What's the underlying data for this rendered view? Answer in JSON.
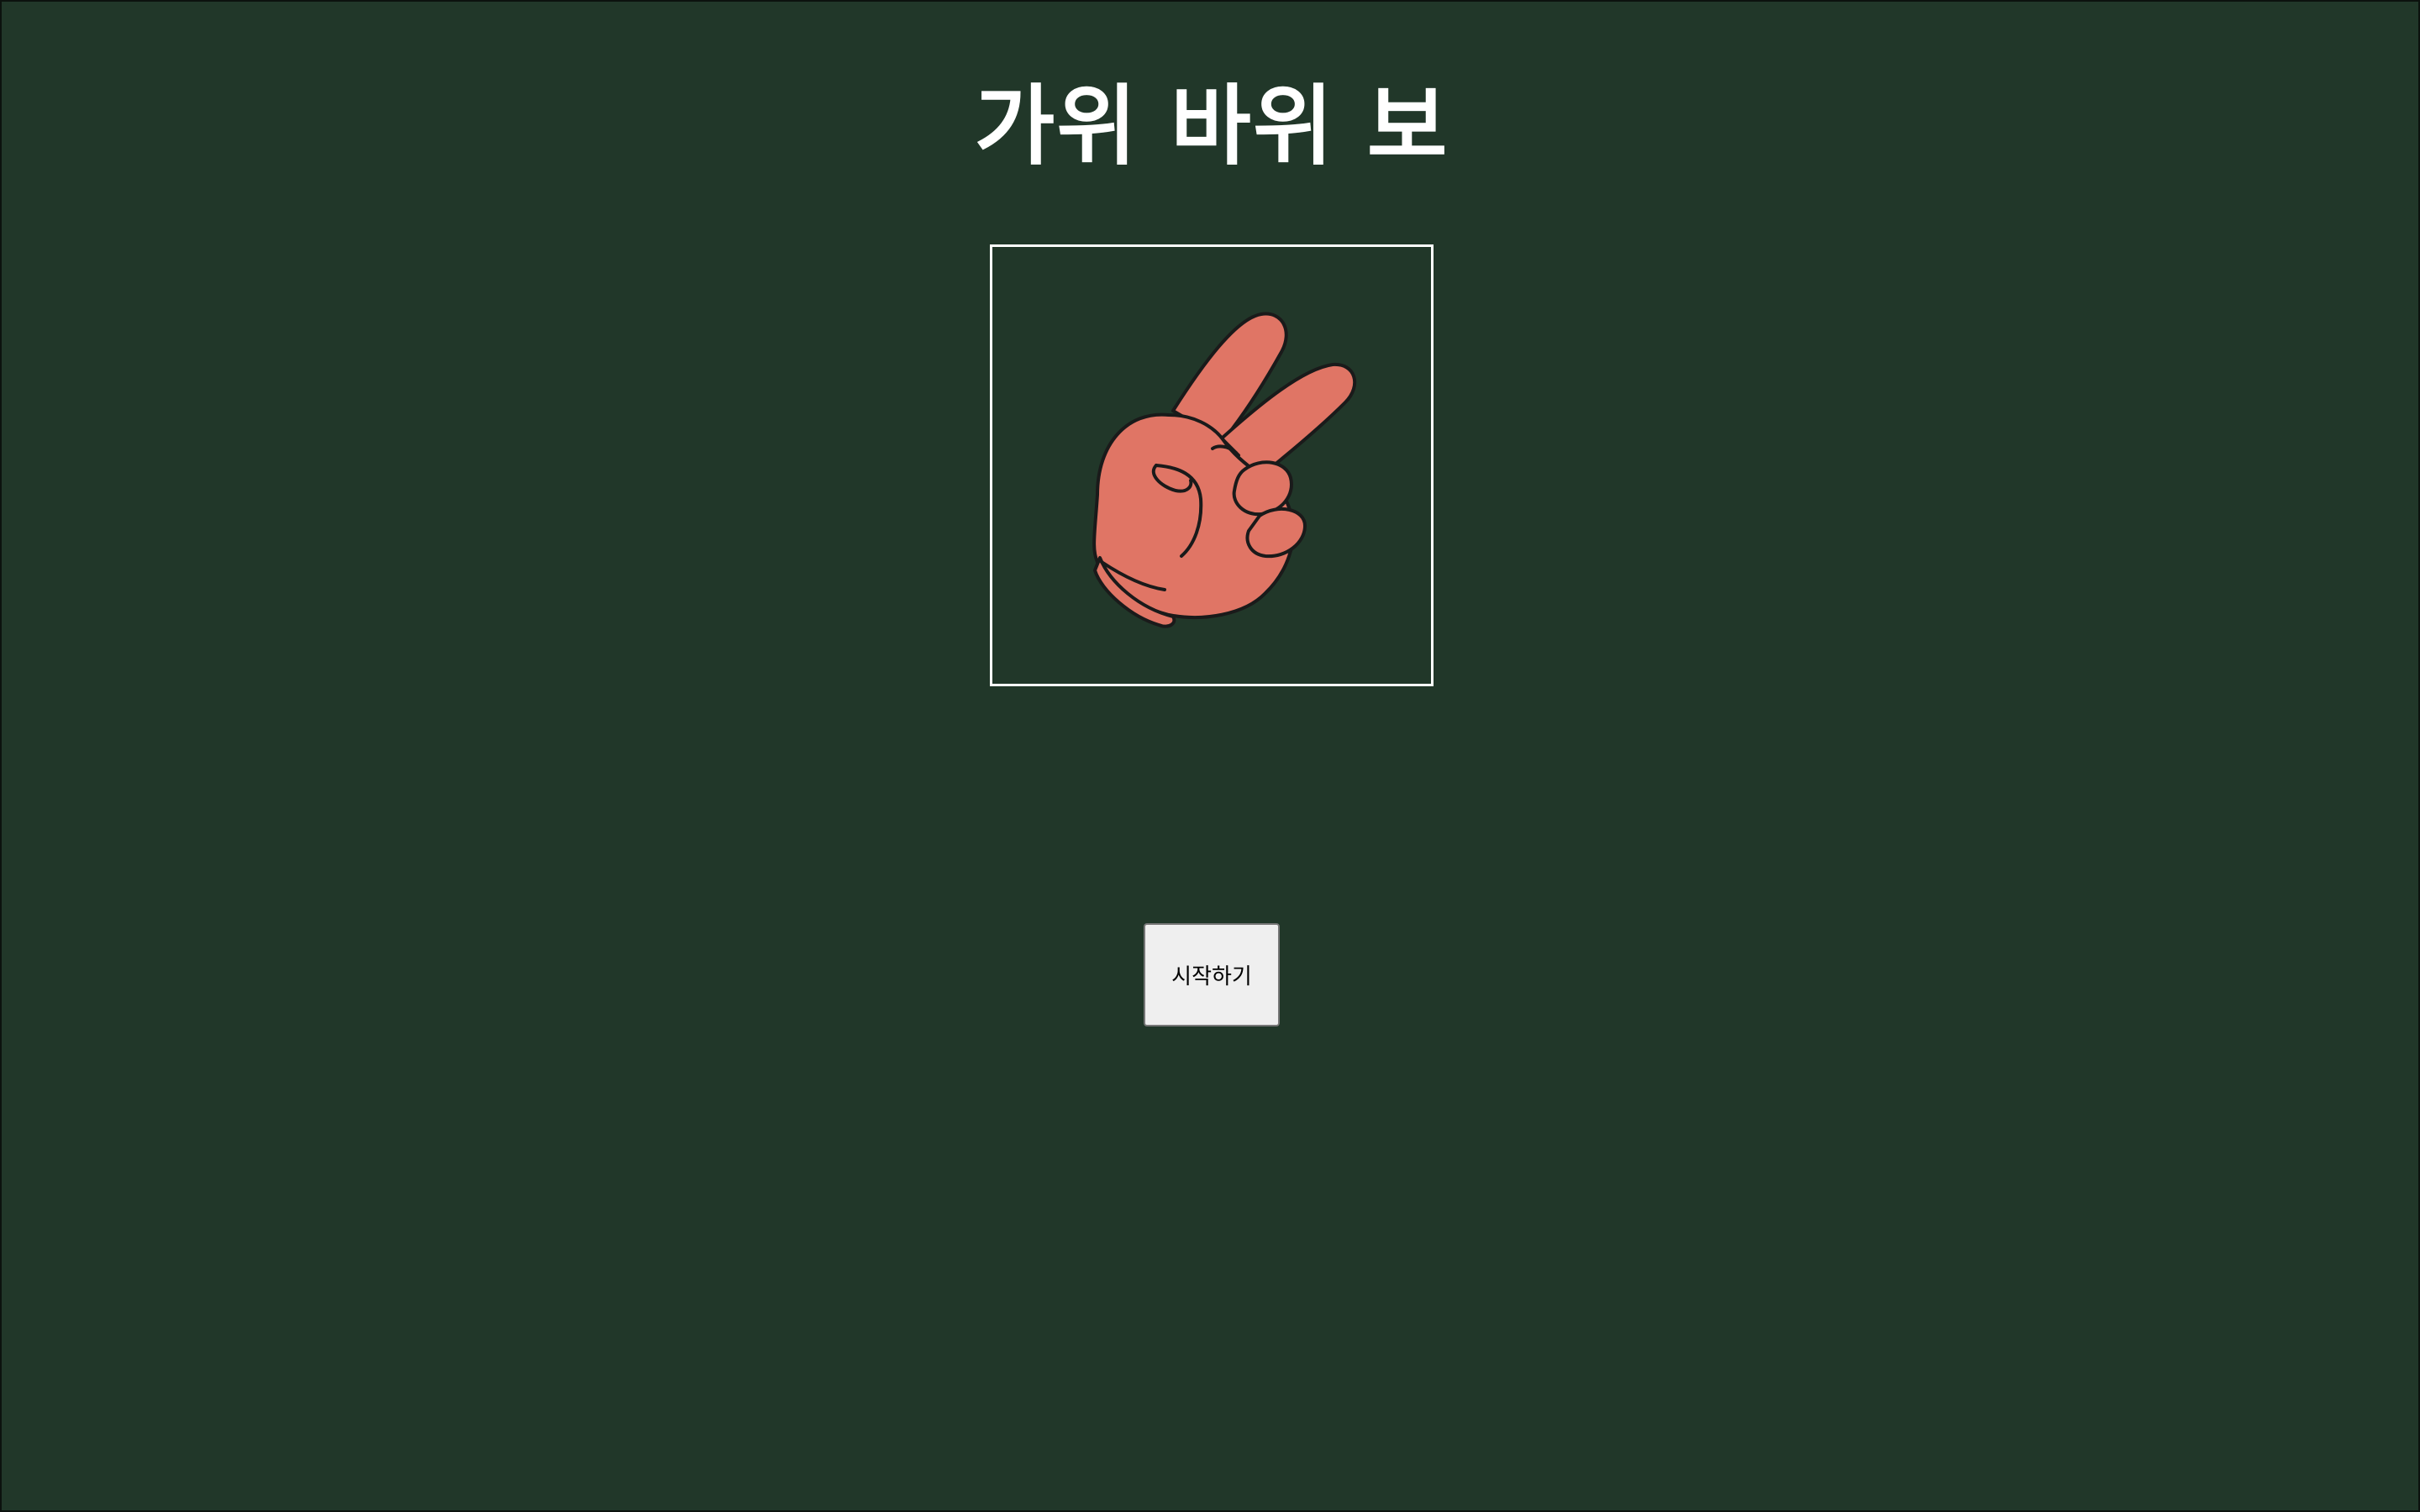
{
  "game": {
    "title": "가위 바위 보",
    "hand_icon": "scissors-hand-icon",
    "start_label": "시작하기"
  },
  "colors": {
    "background": "#213729",
    "hand_fill": "#e07565",
    "frame_border": "#ffffff"
  }
}
